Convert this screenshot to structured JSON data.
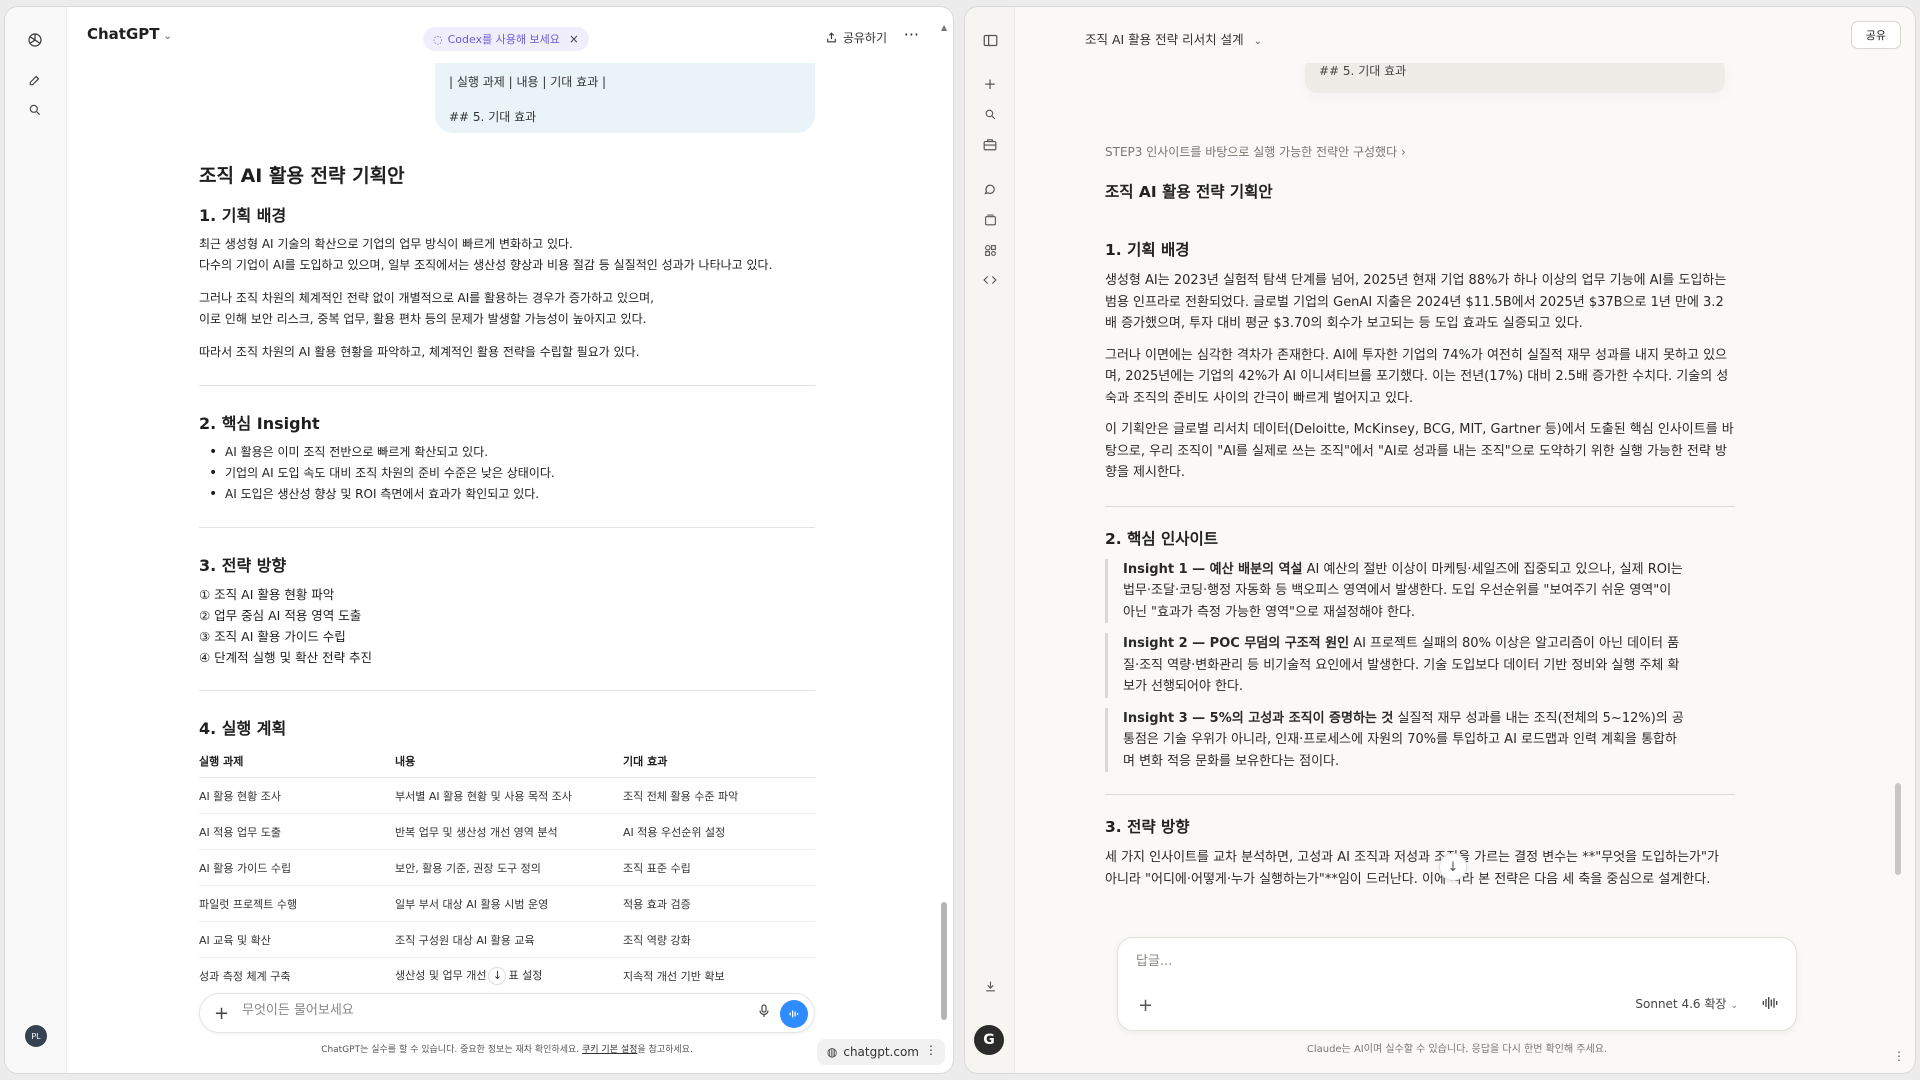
{
  "left": {
    "brand": "ChatGPT",
    "pill": "Codex를 사용해 보세요",
    "share": "공유하기",
    "bubble": [
      "| 실행 과제 | 내용 | 기대 효과 |",
      "## 5. 기대 효과"
    ],
    "doc": {
      "title": "조직 AI 활용 전략 기획안",
      "s1": {
        "heading": "1. 기획 배경",
        "p1": "최근 생성형 AI 기술의 확산으로 기업의 업무 방식이 빠르게 변화하고 있다.",
        "p2": "다수의 기업이 AI를 도입하고 있으며, 일부 조직에서는 생산성 향상과 비용 절감 등 실질적인 성과가 나타나고 있다.",
        "p3": "그러나 조직 차원의 체계적인 전략 없이 개별적으로 AI를 활용하는 경우가 증가하고 있으며,",
        "p4": "이로 인해 보안 리스크, 중복 업무, 활용 편차 등의 문제가 발생할 가능성이 높아지고 있다.",
        "p5": "따라서 조직 차원의 AI 활용 현황을 파악하고, 체계적인 활용 전략을 수립할 필요가 있다."
      },
      "s2": {
        "heading": "2. 핵심 Insight",
        "b1": "AI 활용은 이미 조직 전반으로 빠르게 확산되고 있다.",
        "b2": "기업의 AI 도입 속도 대비 조직 차원의 준비 수준은 낮은 상태이다.",
        "b3": "AI 도입은 생산성 향상 및 ROI 측면에서 효과가 확인되고 있다."
      },
      "s3": {
        "heading": "3. 전략 방향",
        "i1": "① 조직 AI 활용 현황 파악",
        "i2": "② 업무 중심 AI 적용 영역 도출",
        "i3": "③ 조직 AI 활용 가이드 수립",
        "i4": "④ 단계적 실행 및 확산 전략 추진"
      },
      "s4": {
        "heading": "4. 실행 계획",
        "headers": [
          "실행 과제",
          "내용",
          "기대 효과"
        ],
        "rows": [
          [
            "AI 활용 현황 조사",
            "부서별 AI 활용 현황 및 사용 목적 조사",
            "조직 전체 활용 수준 파악"
          ],
          [
            "AI 적용 업무 도출",
            "반복 업무 및 생산성 개선 영역 분석",
            "AI 적용 우선순위 설정"
          ],
          [
            "AI 활용 가이드 수립",
            "보안, 활용 기준, 권장 도구 정의",
            "조직 표준 수립"
          ],
          [
            "파일럿 프로젝트 수행",
            "일부 부서 대상 AI 활용 시범 운영",
            "적용 효과 검증"
          ],
          [
            "AI 교육 및 확산",
            "조직 구성원 대상 AI 활용 교육",
            "조직 역량 강화"
          ],
          [
            "성과 측정 체계 구축",
            "생산성 및 업무 개선",
            "지속적 개선 기반 확보"
          ]
        ],
        "last_row_mid_suffix": "표 설정"
      }
    },
    "input_placeholder": "무엇이든 물어보세요",
    "disclaimer_prefix": "ChatGPT는 실수를 할 수 있습니다. 중요한 정보는 재차 확인하세요. ",
    "disclaimer_link": "쿠키 기본 설정",
    "disclaimer_suffix": "을 참고하세요.",
    "site": "chatgpt.com",
    "avatar": "PL"
  },
  "right": {
    "title": "조직 AI 활용 전략 리서치 설계",
    "share": "공유",
    "bubble": "## 5. 기대 효과",
    "meta": "STEP3 인사이트를 바탕으로 실행 가능한 전략안 구성했다",
    "doc": {
      "title": "조직 AI 활용 전략 기획안",
      "s1": {
        "heading": "1. 기획 배경",
        "p1": "생성형 AI는 2023년 실험적 탐색 단계를 넘어, 2025년 현재 기업 88%가 하나 이상의 업무 기능에 AI를 도입하는 범용 인프라로 전환되었다. 글로벌 기업의 GenAI 지출은 2024년 $11.5B에서 2025년 $37B으로 1년 만에 3.2배 증가했으며, 투자 대비 평균 $3.70의 회수가 보고되는 등 도입 효과도 실증되고 있다.",
        "p2": "그러나 이면에는 심각한 격차가 존재한다. AI에 투자한 기업의 74%가 여전히 실질적 재무 성과를 내지 못하고 있으며, 2025년에는 기업의 42%가 AI 이니셔티브를 포기했다. 이는 전년(17%) 대비 2.5배 증가한 수치다. 기술의 성숙과 조직의 준비도 사이의 간극이 빠르게 벌어지고 있다.",
        "p3": "이 기획안은 글로벌 리서치 데이터(Deloitte, McKinsey, BCG, MIT, Gartner 등)에서 도출된 핵심 인사이트를 바탕으로, 우리 조직이 \"AI를 실제로 쓰는 조직\"에서 \"AI로 성과를 내는 조직\"으로 도약하기 위한 실행 가능한 전략 방향을 제시한다."
      },
      "s2": {
        "heading": "2. 핵심 인사이트",
        "q1_title": "Insight 1 — 예산 배분의 역설",
        "q1_body": " AI 예산의 절반 이상이 마케팅·세일즈에 집중되고 있으나, 실제 ROI는 법무·조달·코딩·행정 자동화 등 백오피스 영역에서 발생한다. 도입 우선순위를 \"보여주기 쉬운 영역\"이 아닌 \"효과가 측정 가능한 영역\"으로 재설정해야 한다.",
        "q2_title": "Insight 2 — POC 무덤의 구조적 원인",
        "q2_body": " AI 프로젝트 실패의 80% 이상은 알고리즘이 아닌 데이터 품질·조직 역량·변화관리 등 비기술적 요인에서 발생한다. 기술 도입보다 데이터 기반 정비와 실행 주체 확보가 선행되어야 한다.",
        "q3_title": "Insight 3 — 5%의 고성과 조직이 증명하는 것",
        "q3_body": " 실질적 재무 성과를 내는 조직(전체의 5~12%)의 공통점은 기술 우위가 아니라, 인재·프로세스에 자원의 70%를 투입하고 AI 로드맵과 인력 계획을 통합하며 변화 적응 문화를 보유한다는 점이다."
      },
      "s3": {
        "heading": "3. 전략 방향",
        "p1": "세 가지 인사이트를 교차 분석하면, 고성과 AI 조직과 저성과 조직을 가르는 결정 변수는 **\"무엇을 도입하는가\"가 아니라 \"어디에·어떻게·누가 실행하는가\"**임이 드러난다. 이에 따라 본 전략은 다음 세 축을 중심으로 설계한다."
      }
    },
    "input_placeholder": "답글...",
    "model": "Sonnet 4.6 확장",
    "disclaimer": "Claude는 AI이며 실수할 수 있습니다. 응답을 다시 한번 확인해 주세요.",
    "avatar": "G"
  },
  "icons": {
    "accent_blue": "#2f8cff",
    "codex_purple": "#6b5dd3"
  }
}
